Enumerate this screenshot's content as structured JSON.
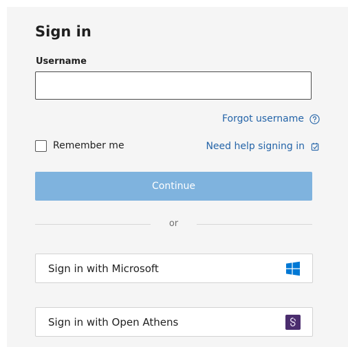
{
  "form": {
    "title": "Sign in",
    "username_label": "Username",
    "username_value": "",
    "username_placeholder": ""
  },
  "forgot_username": {
    "label": "Forgot username",
    "icon": "question-circle-icon"
  },
  "remember_me": {
    "label": "Remember me",
    "checked": false
  },
  "help_link": {
    "label": "Need help signing in",
    "icon": "external-link-icon"
  },
  "continue_button": {
    "label": "Continue",
    "color": "#7fb3de"
  },
  "divider": {
    "text": "or"
  },
  "sso": {
    "microsoft": {
      "label": "Sign in with Microsoft",
      "icon": "windows-logo-icon",
      "icon_color": "#0078d4"
    },
    "open_athens": {
      "label": "Sign in with Open Athens",
      "icon": "open-athens-logo-icon",
      "icon_color": "#4b2d6e"
    }
  },
  "colors": {
    "link": "#2464a8",
    "panel_background": "#f5f5f5"
  }
}
